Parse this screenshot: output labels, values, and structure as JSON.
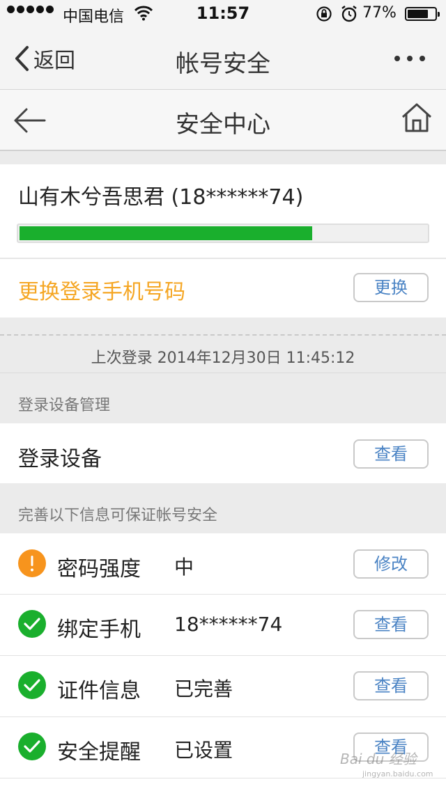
{
  "status_bar": {
    "carrier": "中国电信",
    "time": "11:57",
    "battery_percent": "77%",
    "battery_level": 0.77
  },
  "nav": {
    "back_label": "返回",
    "title": "帐号安全"
  },
  "subnav": {
    "title": "安全中心"
  },
  "account": {
    "name": "山有木兮吾思君 (18******74)",
    "security_level": 0.72,
    "change_phone_label": "更换登录手机号码",
    "change_button": "更换"
  },
  "last_login": "上次登录 2014年12月30日 11:45:12",
  "device_section": {
    "header": "登录设备管理",
    "row_label": "登录设备",
    "button": "查看"
  },
  "info_section": {
    "header": "完善以下信息可保证帐号安全",
    "items": [
      {
        "name": "密码强度",
        "value": "中",
        "button": "修改",
        "status": "warning",
        "icon": "exclamation-icon"
      },
      {
        "name": "绑定手机",
        "value": "18******74",
        "button": "查看",
        "status": "ok",
        "icon": "check-icon"
      },
      {
        "name": "证件信息",
        "value": "已完善",
        "button": "查看",
        "status": "ok",
        "icon": "check-icon"
      },
      {
        "name": "安全提醒",
        "value": "已设置",
        "button": "查看",
        "status": "ok",
        "icon": "check-icon"
      }
    ]
  },
  "colors": {
    "accent_green": "#1aaf2d",
    "warning_orange": "#f7941d",
    "link_blue": "#4a83c4",
    "highlight_orange": "#f5a623"
  },
  "watermark": {
    "logo": "Bai du 经验",
    "url": "jingyan.baidu.com"
  }
}
